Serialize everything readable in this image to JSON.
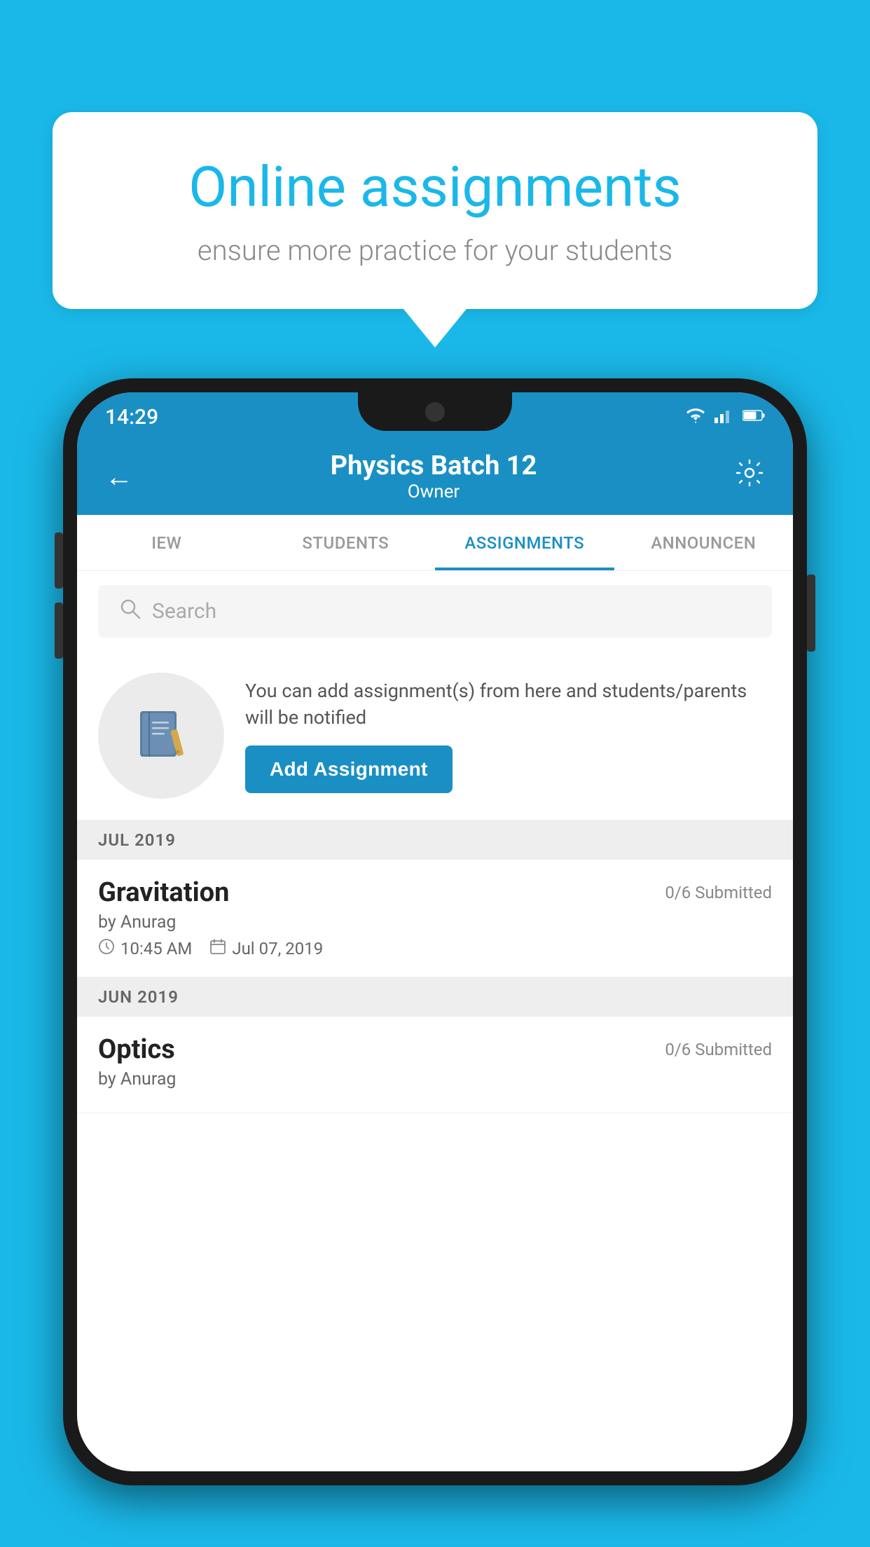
{
  "background_color": "#1ab8e8",
  "speech_bubble": {
    "title": "Online assignments",
    "subtitle": "ensure more practice for your students"
  },
  "phone": {
    "status_bar": {
      "time": "14:29",
      "wifi": "▼",
      "signal": "▲",
      "battery": "▌"
    },
    "header": {
      "title": "Physics Batch 12",
      "subtitle": "Owner",
      "back_label": "←",
      "settings_label": "⚙"
    },
    "tabs": [
      {
        "label": "IEW",
        "active": false
      },
      {
        "label": "STUDENTS",
        "active": false
      },
      {
        "label": "ASSIGNMENTS",
        "active": true
      },
      {
        "label": "ANNOUNCEN",
        "active": false
      }
    ],
    "search": {
      "placeholder": "Search"
    },
    "promo": {
      "description": "You can add assignment(s) from here and students/parents will be notified",
      "button_label": "Add Assignment"
    },
    "sections": [
      {
        "label": "JUL 2019",
        "assignments": [
          {
            "name": "Gravitation",
            "submitted": "0/6 Submitted",
            "by": "by Anurag",
            "time": "10:45 AM",
            "date": "Jul 07, 2019"
          }
        ]
      },
      {
        "label": "JUN 2019",
        "assignments": [
          {
            "name": "Optics",
            "submitted": "0/6 Submitted",
            "by": "by Anurag",
            "time": "",
            "date": ""
          }
        ]
      }
    ]
  }
}
